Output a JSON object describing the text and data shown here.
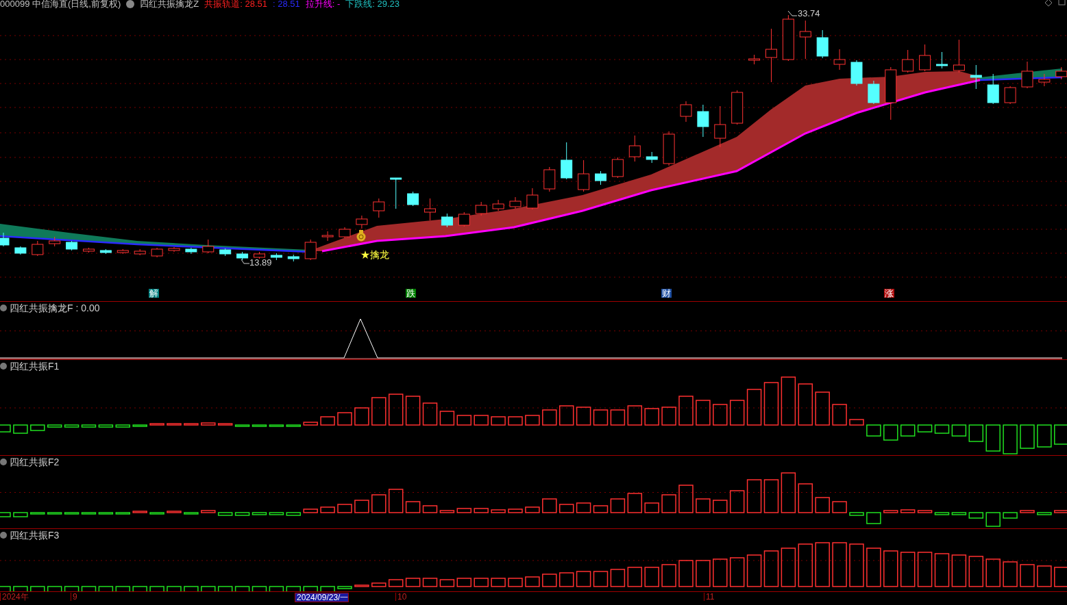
{
  "header": {
    "symbol": "000099 中信海直(日线,前复权)",
    "indicator": "四红共振擒龙Z",
    "readings": [
      {
        "label": "共振轨道: 28.51",
        "color": "#ff2020"
      },
      {
        "label": ": 28.51",
        "color": "#2b2bff"
      },
      {
        "label": "拉升线: -",
        "color": "#ff00ff"
      },
      {
        "label": "下跌线: 29.23",
        "color": "#20c0c0"
      }
    ]
  },
  "main_chart": {
    "high_label": "33.74",
    "low_label": "13.89",
    "signal_label": "★擒龙",
    "markers": [
      {
        "label": "解",
        "color": "#008080"
      },
      {
        "label": "跌",
        "color": "#008000"
      },
      {
        "label": "财",
        "color": "#1f4fa0"
      },
      {
        "label": "涨",
        "color": "#b01010"
      }
    ]
  },
  "panels": [
    {
      "title": "四红共振擒龙F : 0.00",
      "kind": "line"
    },
    {
      "title": "四红共振F1",
      "kind": "bars"
    },
    {
      "title": "四红共振F2",
      "kind": "bars"
    },
    {
      "title": "四红共振F3",
      "kind": "bars"
    }
  ],
  "axis": {
    "labels": [
      {
        "label": "2024年",
        "selected": false
      },
      {
        "label": "9",
        "selected": false
      },
      {
        "label": "2024/09/23/一",
        "selected": true
      },
      {
        "label": "10",
        "selected": false
      },
      {
        "label": "11",
        "selected": false
      }
    ]
  }
}
